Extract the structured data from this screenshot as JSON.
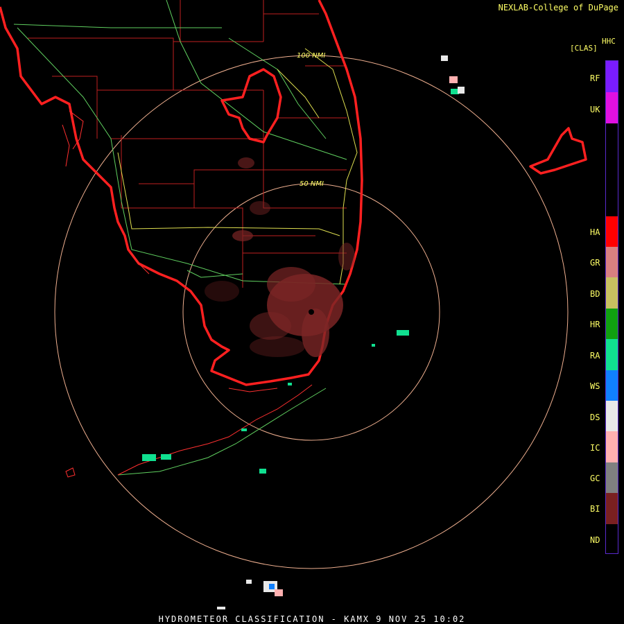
{
  "credit": "NEXLAB-College of DuPage",
  "product_code": "HHC",
  "legend_header": "[CLAS]",
  "range_rings": [
    {
      "label": "100 NMI"
    },
    {
      "label": "50 NMI"
    }
  ],
  "legend": [
    {
      "code": "RF",
      "color": "#7a1cff"
    },
    {
      "code": "UK",
      "color": "#e010e0"
    },
    {
      "code": "HA",
      "color": "#ff0000"
    },
    {
      "code": "GR",
      "color": "#d88080"
    },
    {
      "code": "BD",
      "color": "#c8c060"
    },
    {
      "code": "HR",
      "color": "#10a010"
    },
    {
      "code": "RA",
      "color": "#10e090"
    },
    {
      "code": "WS",
      "color": "#1080ff"
    },
    {
      "code": "DS",
      "color": "#e8e8e8"
    },
    {
      "code": "IC",
      "color": "#ffb0b0"
    },
    {
      "code": "GC",
      "color": "#808080"
    },
    {
      "code": "BI",
      "color": "#7a2020"
    },
    {
      "code": "ND",
      "color": "#000000"
    }
  ],
  "footer": "HYDROMETEOR CLASSIFICATION - KAMX 9 NOV 25 10:02"
}
